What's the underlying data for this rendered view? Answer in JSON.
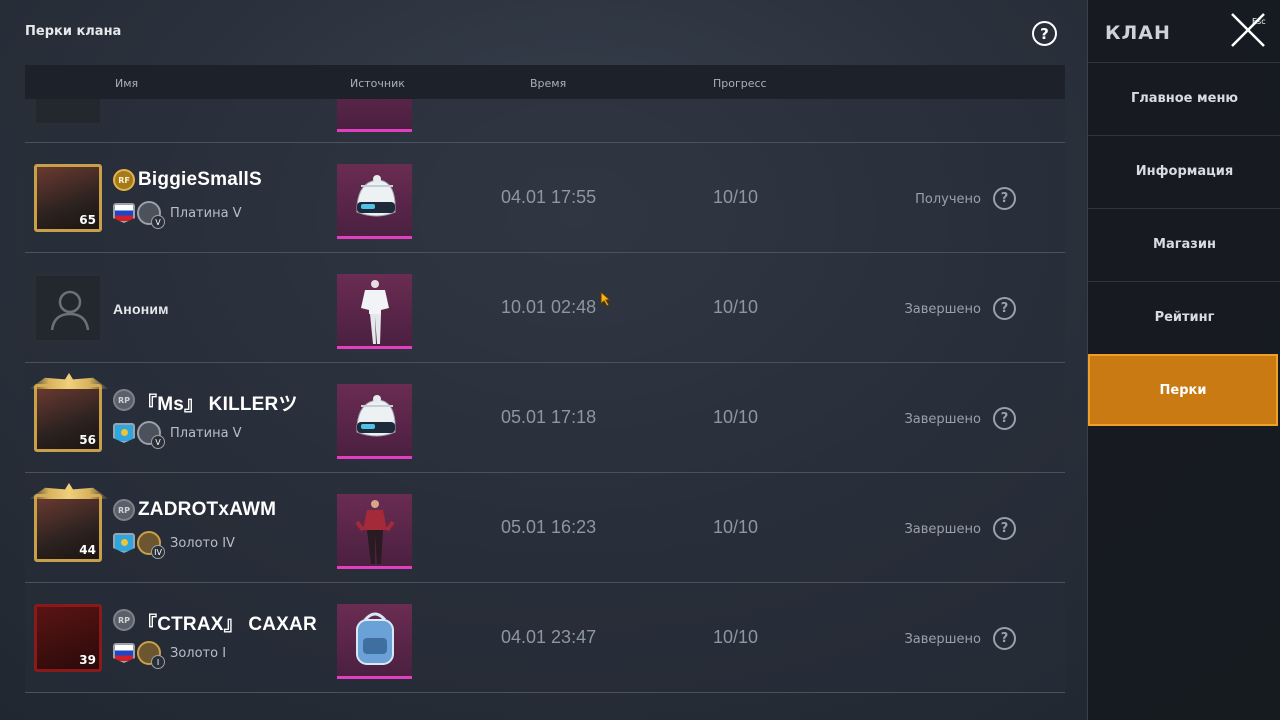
{
  "page": {
    "title": "Перки клана",
    "help_icon": "question-circle-icon"
  },
  "table": {
    "columns": {
      "name": "Имя",
      "source": "Источник",
      "time": "Время",
      "progress": "Прогресс"
    },
    "rows": [
      {
        "name": "BiggieSmallS",
        "rp": "RF",
        "rp_gold": true,
        "flag": "ru",
        "tier": "Платина V",
        "tier_num": "V",
        "level": "65",
        "avatar": "gold-frame",
        "item": "helmet",
        "time": "04.01 17:55",
        "progress": "10/10",
        "status": "Получено"
      },
      {
        "name": "Аноним",
        "anonymous": true,
        "item": "outfit-white",
        "time": "10.01 02:48",
        "progress": "10/10",
        "status": "Завершено"
      },
      {
        "name": "『Ms』 KILLERツ",
        "rp": "RP",
        "flag": "kz",
        "tier": "Платина V",
        "tier_num": "V",
        "level": "56",
        "avatar": "winged-frame",
        "item": "helmet",
        "time": "05.01 17:18",
        "progress": "10/10",
        "status": "Завершено"
      },
      {
        "name": "ZADROTxAWM",
        "rp": "RP",
        "flag": "kz",
        "tier": "Золото IV",
        "tier_num": "IV",
        "level": "44",
        "avatar": "winged-frame",
        "item": "outfit-red",
        "time": "05.01 16:23",
        "progress": "10/10",
        "status": "Завершено"
      },
      {
        "name": "『CTRAX』 CAXAR",
        "rp": "RP",
        "flag": "ru",
        "tier": "Золото I",
        "tier_num": "I",
        "level": "39",
        "avatar": "red-frame",
        "item": "backpack",
        "time": "04.01 23:47",
        "progress": "10/10",
        "status": "Завершено"
      }
    ]
  },
  "sidebar": {
    "title": "КЛАН",
    "close_label": "Esc",
    "items": [
      {
        "label": "Главное меню",
        "active": false
      },
      {
        "label": "Информация",
        "active": false
      },
      {
        "label": "Магазин",
        "active": false
      },
      {
        "label": "Рейтинг",
        "active": false
      },
      {
        "label": "Перки",
        "active": true
      }
    ]
  },
  "colors": {
    "accent": "#c97a12",
    "source_bg": "#5a2648",
    "source_border": "#e040c0"
  }
}
